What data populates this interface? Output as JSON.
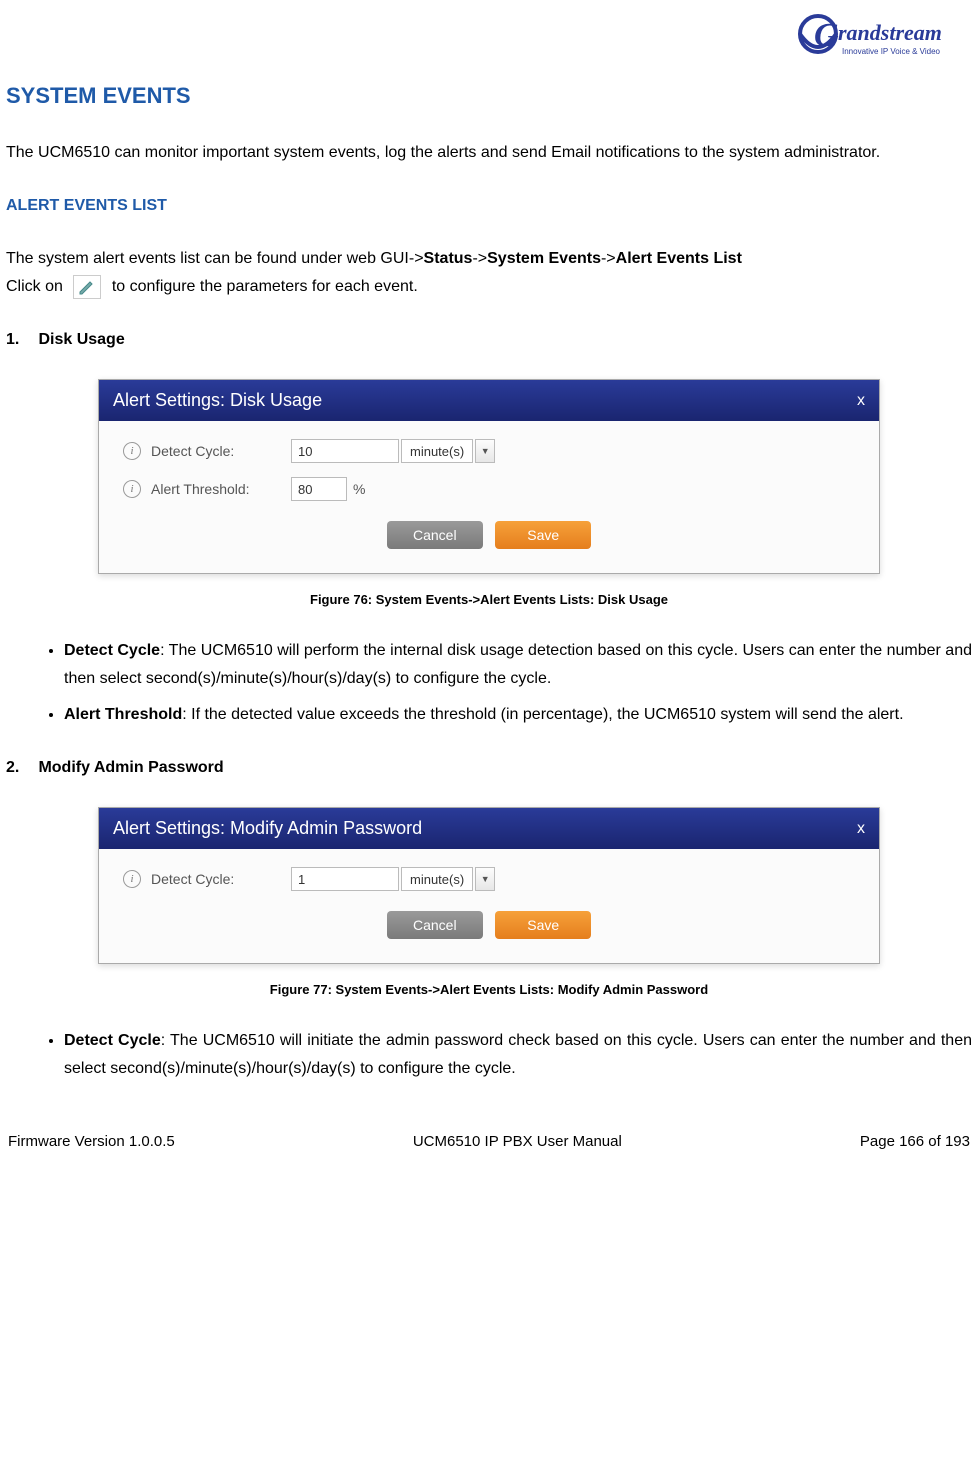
{
  "logo": {
    "brand": "Grandstream",
    "tagline": "Innovative IP Voice & Video"
  },
  "headings": {
    "system_events": "SYSTEM EVENTS",
    "alert_events_list": "ALERT EVENTS LIST"
  },
  "paragraphs": {
    "intro": "The UCM6510 can monitor important system events, log the alerts and send Email notifications to the system administrator.",
    "alert_events_path_pre": "The system alert events list can be found under web GUI->",
    "path_status": "Status",
    "path_sep": "->",
    "path_system_events": "System Events",
    "path_alert_list": "Alert Events List",
    "click_on_pre": "Click on ",
    "click_on_post": " to configure the parameters for each event."
  },
  "items": {
    "one_num": "1.",
    "one_title": "Disk Usage",
    "two_num": "2.",
    "two_title": "Modify Admin Password"
  },
  "dialog1": {
    "title": "Alert Settings: Disk Usage",
    "close": "x",
    "detect_cycle_label": "Detect Cycle:",
    "detect_cycle_value": "10",
    "unit": "minute(s)",
    "alert_threshold_label": "Alert Threshold:",
    "alert_threshold_value": "80",
    "pct": "%",
    "cancel": "Cancel",
    "save": "Save"
  },
  "dialog2": {
    "title": "Alert Settings: Modify Admin Password",
    "close": "x",
    "detect_cycle_label": "Detect Cycle:",
    "detect_cycle_value": "1",
    "unit": "minute(s)",
    "cancel": "Cancel",
    "save": "Save"
  },
  "captions": {
    "fig76": "Figure 76: System Events->Alert Events Lists: Disk Usage",
    "fig77": "Figure 77: System Events->Alert Events Lists: Modify Admin Password"
  },
  "bullets1": {
    "b1_label": "Detect Cycle",
    "b1_text": ": The UCM6510 will perform the internal disk usage detection based on this cycle. Users can enter the number and then select second(s)/minute(s)/hour(s)/day(s) to configure the cycle.",
    "b2_label": "Alert Threshold",
    "b2_text": ": If the detected value exceeds the threshold (in percentage), the UCM6510 system will send the alert."
  },
  "bullets2": {
    "b1_label": "Detect Cycle",
    "b1_text": ": The UCM6510 will initiate the admin password check based on this cycle. Users can enter the number and then select second(s)/minute(s)/hour(s)/day(s) to configure the cycle."
  },
  "footer": {
    "left": "Firmware Version 1.0.0.5",
    "center": "UCM6510 IP PBX User Manual",
    "right": "Page 166 of 193"
  },
  "period": "."
}
